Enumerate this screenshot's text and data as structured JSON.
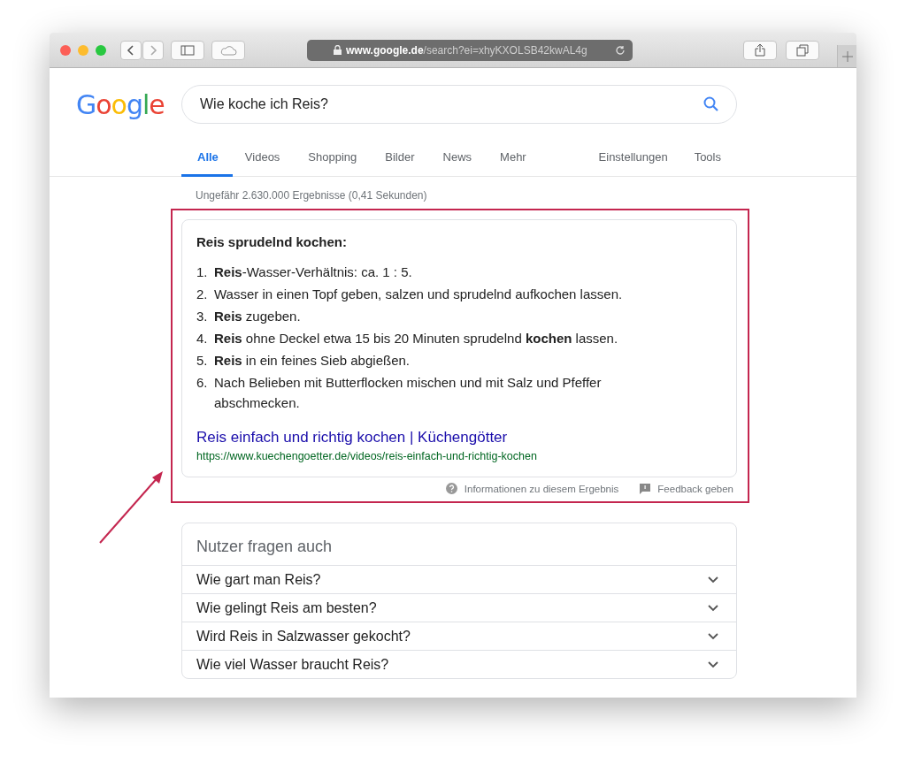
{
  "browser": {
    "url_host": "www.google.de",
    "url_path": "/search?ei=xhyKXOLSB42kwAL4g"
  },
  "logo": {
    "text": "Google"
  },
  "search": {
    "value": "Wie koche ich Reis?"
  },
  "tabs": [
    {
      "label": "Alle",
      "selected": true
    },
    {
      "label": "Videos",
      "selected": false
    },
    {
      "label": "Shopping",
      "selected": false
    },
    {
      "label": "Bilder",
      "selected": false
    },
    {
      "label": "News",
      "selected": false
    },
    {
      "label": "Mehr",
      "selected": false
    }
  ],
  "tools": [
    "Einstellungen",
    "Tools"
  ],
  "result_stats": "Ungefähr 2.630.000 Ergebnisse (0,41 Sekunden)",
  "featured_snippet": {
    "heading": "Reis sprudelnd kochen:",
    "steps": [
      {
        "number": "1.",
        "text": "**Reis**-Wasser-Verhältnis: ca. 1 : 5."
      },
      {
        "number": "2.",
        "text": "Wasser in einen Topf geben, salzen und sprudelnd aufkochen lassen."
      },
      {
        "number": "3.",
        "text": "**Reis** zugeben."
      },
      {
        "number": "4.",
        "text": "**Reis** ohne Deckel etwa 15 bis 20 Minuten sprudelnd **kochen** lassen."
      },
      {
        "number": "5.",
        "text": "**Reis** in ein feines Sieb abgießen."
      },
      {
        "number": "6.",
        "text": "Nach Belieben mit Butterflocken mischen und mit Salz und Pfeffer abschmecken."
      }
    ],
    "link_title": "Reis einfach und richtig kochen | Küchengötter",
    "link_url": "https://www.kuechengoetter.de/videos/reis-einfach-und-richtig-kochen",
    "footer": [
      "Informationen zu diesem Ergebnis",
      "Feedback geben"
    ]
  },
  "people_also_ask": {
    "title": "Nutzer fragen auch",
    "questions": [
      "Wie gart man Reis?",
      "Wie gelingt Reis am besten?",
      "Wird Reis in Salzwasser gekocht?",
      "Wie viel Wasser braucht Reis?"
    ]
  }
}
